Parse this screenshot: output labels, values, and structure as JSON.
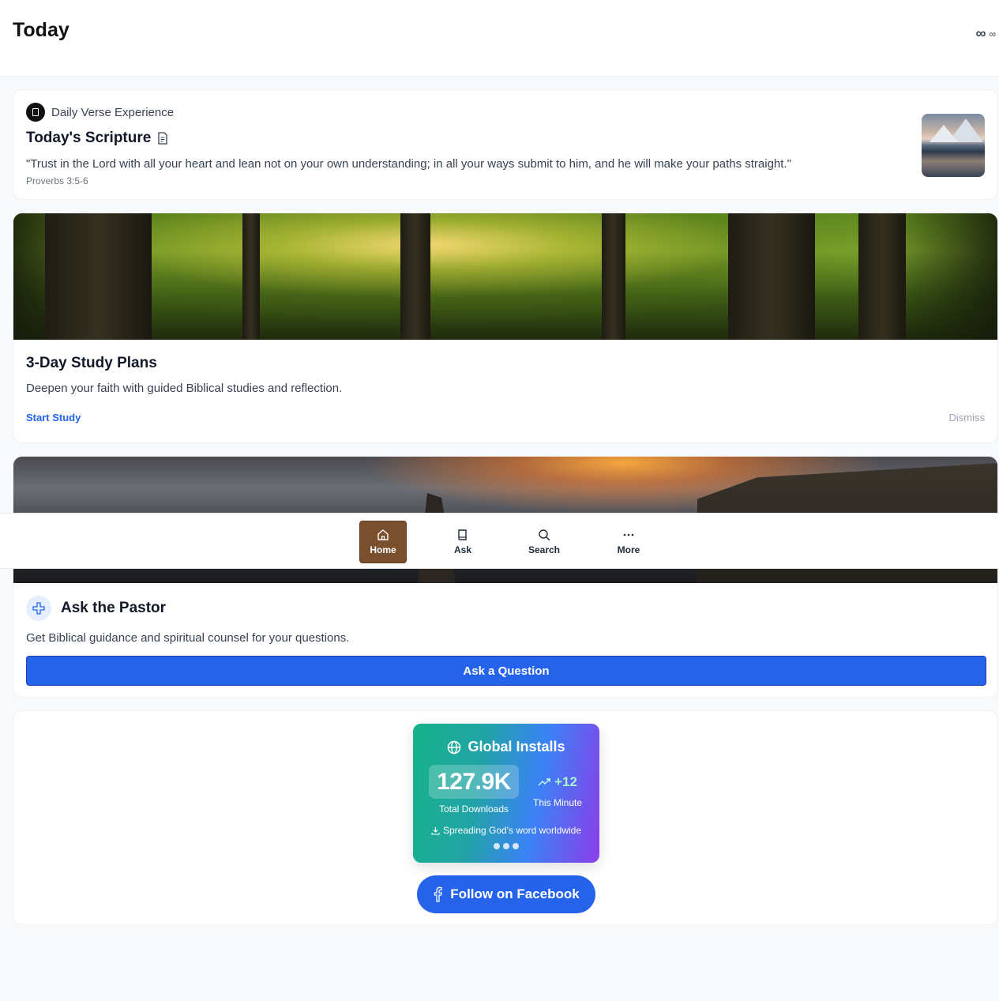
{
  "header": {
    "title": "Today",
    "infinity_big": "∞",
    "infinity_small": "∞"
  },
  "verse": {
    "eyebrow": "Daily Verse Experience",
    "heading": "Today's Scripture",
    "quote": "\"Trust in the Lord with all your heart and lean not on your own understanding; in all your ways submit to him, and he will make your paths straight.\"",
    "reference": "Proverbs 3:5-6"
  },
  "study": {
    "title": "3-Day Study Plans",
    "description": "Deepen your faith with guided Biblical studies and reflection.",
    "start_label": "Start Study",
    "dismiss_label": "Dismiss"
  },
  "pastor": {
    "title": "Ask the Pastor",
    "description": "Get Biblical guidance and spiritual counsel for your questions.",
    "button_label": "Ask a Question"
  },
  "nav": {
    "items": [
      {
        "label": "Home",
        "icon": "home-icon",
        "active": true
      },
      {
        "label": "Ask",
        "icon": "book-icon",
        "active": false
      },
      {
        "label": "Search",
        "icon": "search-icon",
        "active": false
      },
      {
        "label": "More",
        "icon": "more-icon",
        "active": false
      }
    ]
  },
  "installs": {
    "title": "Global Installs",
    "total": "127.9K",
    "total_label": "Total Downloads",
    "delta": "+12",
    "delta_label": "This Minute",
    "tagline": "Spreading God's word worldwide"
  },
  "facebook": {
    "label": "Follow on Facebook"
  },
  "colors": {
    "accent": "#2563eb",
    "nav_active": "#7a4f2e"
  }
}
